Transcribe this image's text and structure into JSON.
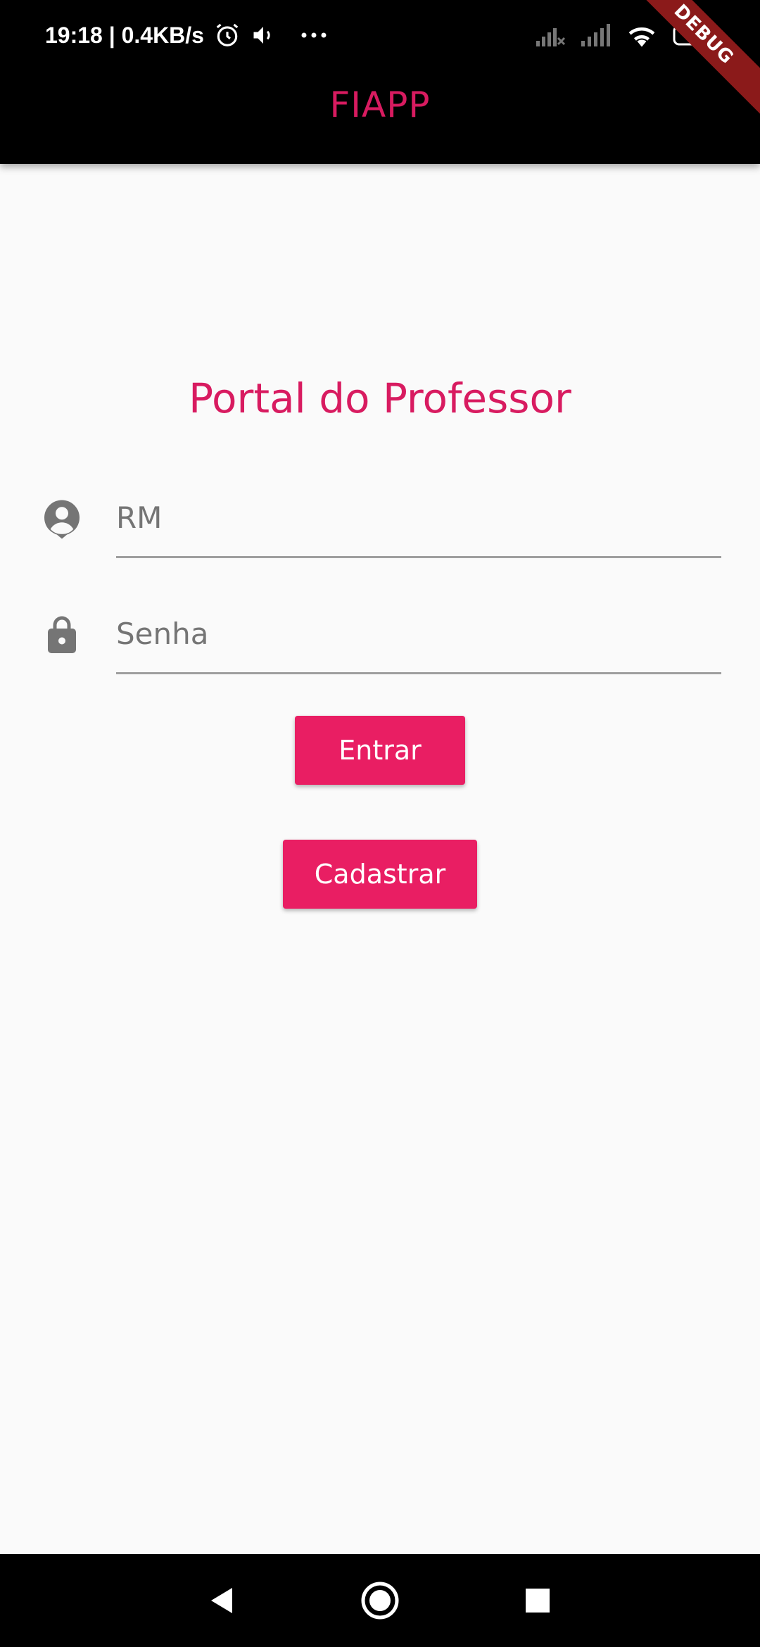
{
  "colors": {
    "accent": "#e91e63",
    "title": "#d81b60",
    "appbar_bg": "#000000",
    "background": "#fafafa",
    "icon_gray": "#757575",
    "debug_ribbon": "#8b1a1a"
  },
  "status_bar": {
    "time_and_speed": "19:18 | 0.4KB/s",
    "icons_left": [
      "alarm-icon",
      "volume-icon",
      "more-dots-icon"
    ],
    "icons_right": [
      "signal-off-icon",
      "signal-icon",
      "wifi-icon",
      "battery-charging-icon"
    ]
  },
  "app_bar": {
    "title": "FIAPP"
  },
  "debug_banner": {
    "label": "DEBUG"
  },
  "login": {
    "title": "Portal do Professor",
    "rm_field": {
      "placeholder": "RM",
      "value": "",
      "icon": "account-circle-icon"
    },
    "password_field": {
      "placeholder": "Senha",
      "value": "",
      "icon": "lock-icon"
    },
    "login_button": "Entrar",
    "register_button": "Cadastrar"
  },
  "nav_bar": {
    "buttons": [
      "back-icon",
      "home-icon",
      "recents-icon"
    ]
  }
}
